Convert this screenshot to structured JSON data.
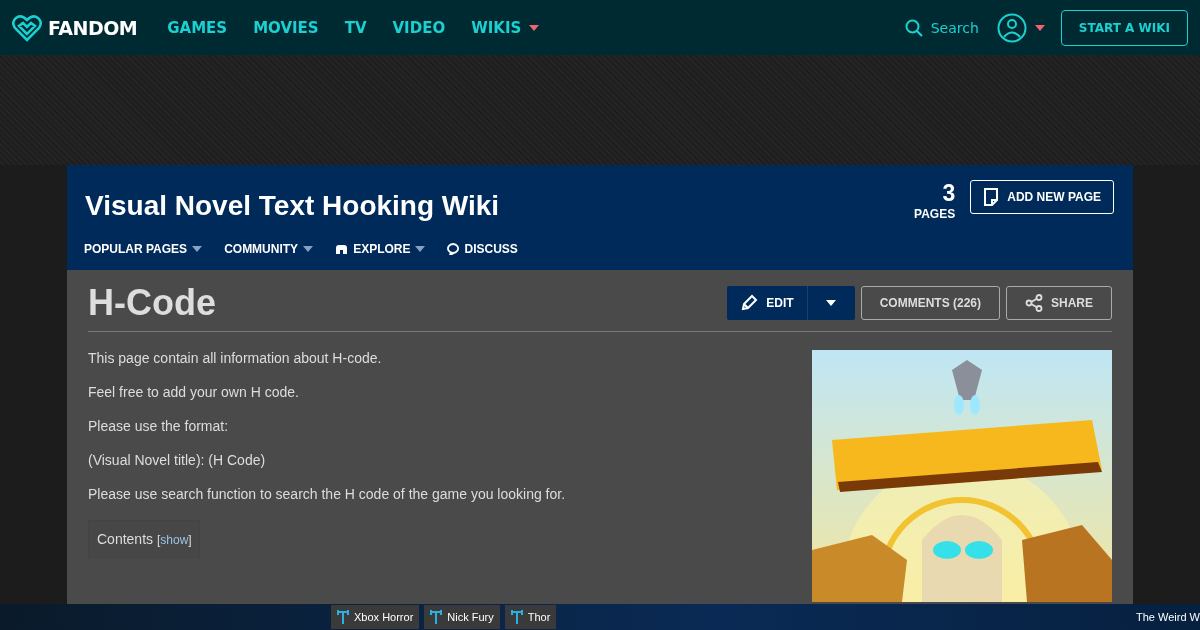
{
  "top_nav": {
    "logo": "FANDOM",
    "links": [
      {
        "label": "GAMES",
        "has_menu": false
      },
      {
        "label": "MOVIES",
        "has_menu": false
      },
      {
        "label": "TV",
        "has_menu": false
      },
      {
        "label": "VIDEO",
        "has_menu": false
      },
      {
        "label": "WIKIS",
        "has_menu": true
      }
    ],
    "search": "Search",
    "cta": "START A WIKI"
  },
  "wiki_header": {
    "title": "Visual Novel Text Hooking Wiki",
    "page_count": "3",
    "page_count_label": "PAGES",
    "add_button": "ADD NEW PAGE",
    "nav": [
      {
        "label": "POPULAR PAGES",
        "kind": "plain",
        "has_menu": true
      },
      {
        "label": "COMMUNITY",
        "kind": "plain",
        "has_menu": true
      },
      {
        "label": "EXPLORE",
        "kind": "explore",
        "has_menu": true
      },
      {
        "label": "DISCUSS",
        "kind": "discuss",
        "has_menu": false
      }
    ]
  },
  "article": {
    "title": "H-Code",
    "edit": "EDIT",
    "comments": "COMMENTS (226)",
    "share": "SHARE",
    "paragraphs": [
      "This page contain all information about H-code.",
      "Feel free to add your own H code.",
      "Please use the format:",
      "(Visual Novel title): (H Code)",
      "Please use search function to search the H code of the game you looking for."
    ],
    "toc": {
      "label": "Contents",
      "bracket_open": "[",
      "toggle": "show",
      "bracket_close": "]"
    }
  },
  "bottom_bar": {
    "items": [
      "Xbox Horror",
      "Nick Fury",
      "Thor"
    ],
    "ticker": "The Weird W"
  }
}
